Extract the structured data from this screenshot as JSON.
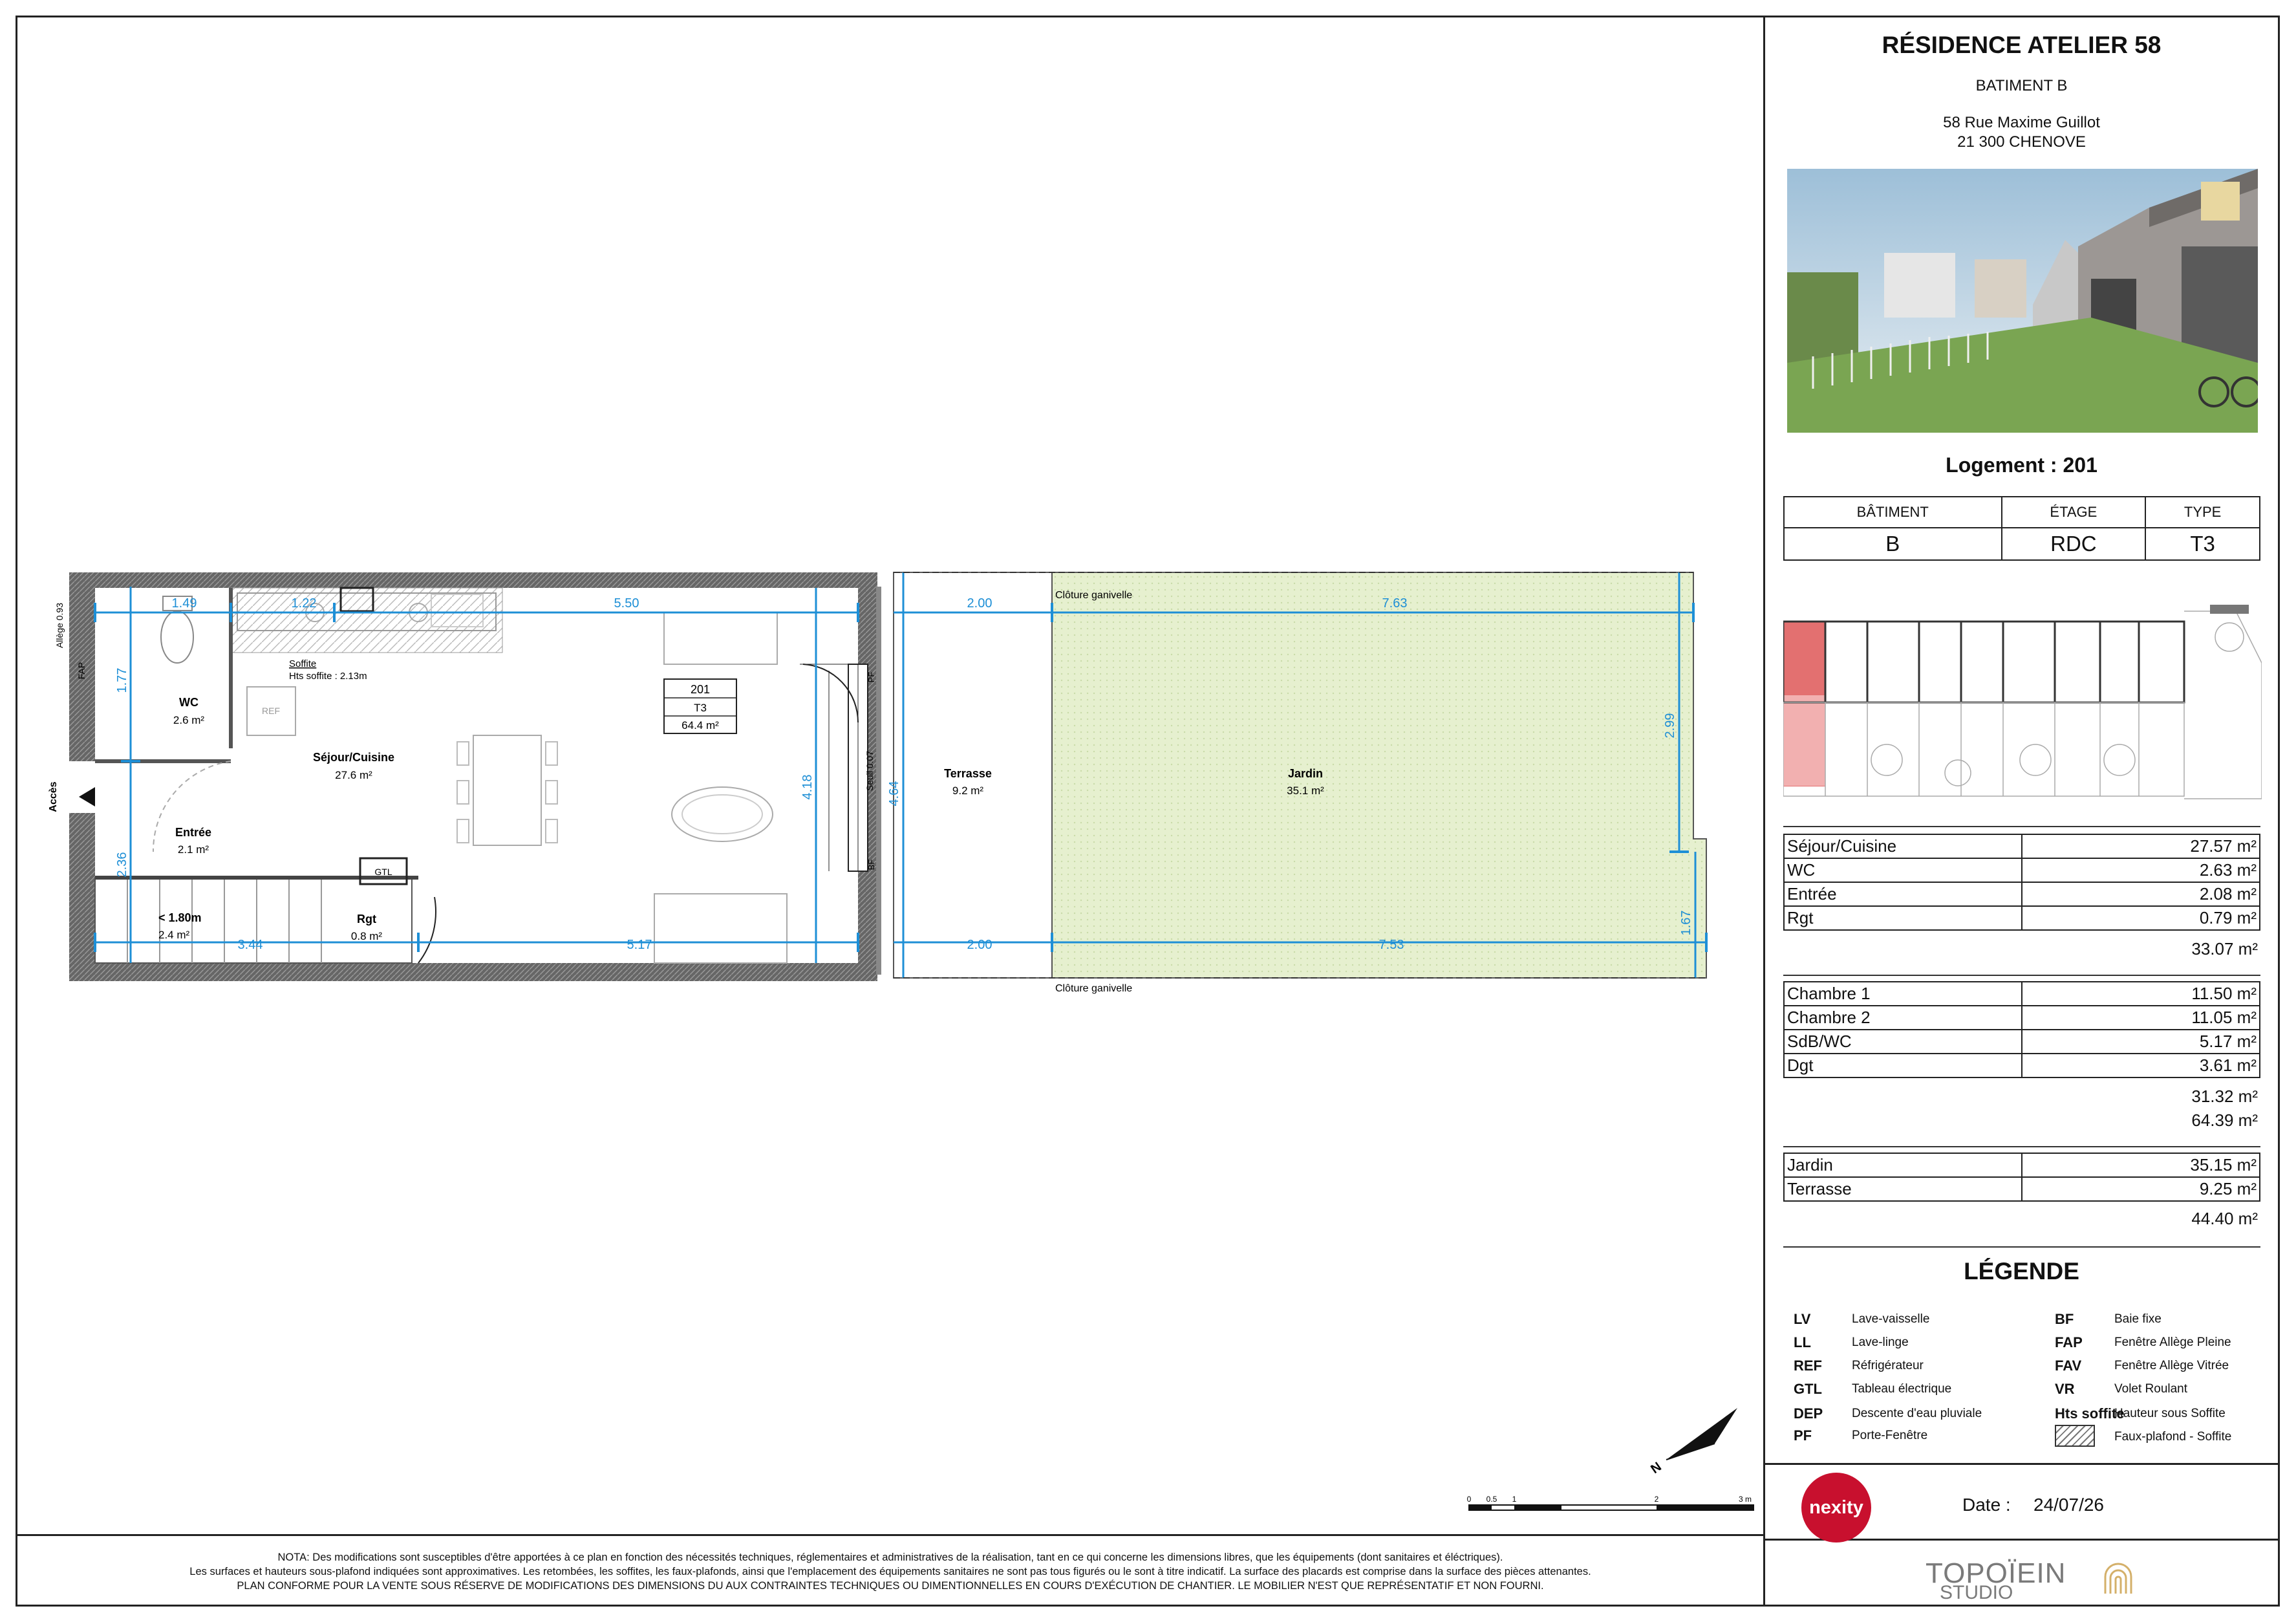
{
  "title": {
    "residence": "RÉSIDENCE ATELIER 58",
    "batiment": "BATIMENT B",
    "address_line1": "58 Rue Maxime Guillot",
    "address_line2": "21 300 CHENOVE",
    "logement": "Logement : 201"
  },
  "info_table": {
    "headers": [
      "BÂTIMENT",
      "ÉTAGE",
      "TYPE"
    ],
    "values": [
      "B",
      "RDC",
      "T3"
    ]
  },
  "surfaces": {
    "group1": [
      {
        "label": "Séjour/Cuisine",
        "value": "27.57 m²"
      },
      {
        "label": "WC",
        "value": "2.63 m²"
      },
      {
        "label": "Entrée",
        "value": "2.08 m²"
      },
      {
        "label": "Rgt",
        "value": "0.79 m²"
      }
    ],
    "group1_total": "33.07 m²",
    "group2": [
      {
        "label": "Chambre 1",
        "value": "11.50 m²"
      },
      {
        "label": "Chambre 2",
        "value": "11.05 m²"
      },
      {
        "label": "SdB/WC",
        "value": "5.17 m²"
      },
      {
        "label": "Dgt",
        "value": "3.61 m²"
      }
    ],
    "group2_total": "31.32 m²",
    "grand_total": "64.39 m²",
    "group3": [
      {
        "label": "Jardin",
        "value": "35.15 m²"
      },
      {
        "label": "Terrasse",
        "value": "9.25 m²"
      }
    ],
    "group3_total": "44.40 m²"
  },
  "legend": {
    "title": "LÉGENDE",
    "left": [
      {
        "code": "LV",
        "label": "Lave-vaisselle"
      },
      {
        "code": "LL",
        "label": "Lave-linge"
      },
      {
        "code": "REF",
        "label": "Réfrigérateur"
      },
      {
        "code": "GTL",
        "label": "Tableau électrique"
      },
      {
        "code": "DEP",
        "label": "Descente d'eau pluviale"
      },
      {
        "code": "PF",
        "label": "Porte-Fenêtre"
      }
    ],
    "right": [
      {
        "code": "BF",
        "label": "Baie fixe"
      },
      {
        "code": "FAP",
        "label": "Fenêtre Allège Pleine"
      },
      {
        "code": "FAV",
        "label": "Fenêtre Allège Vitrée"
      },
      {
        "code": "VR",
        "label": "Volet Roulant"
      },
      {
        "code": "Hts soffite",
        "label": "Hauteur sous Soffite"
      },
      {
        "code": "",
        "label": "Faux-plafond - Soffite"
      }
    ]
  },
  "footer": {
    "brand": "nexity",
    "date_label": "Date :",
    "date_value": "24/07/26",
    "studio_name": "TOPOÏEIN",
    "studio_sub": "STUDIO",
    "note_line1": "NOTA: Des modifications sont susceptibles d'être apportées à ce plan en fonction des nécessités techniques, réglementaires et administratives de la réalisation, tant en ce qui concerne les dimensions libres, que les équipements (dont sanitaires et éléctriques).",
    "note_line2": "Les surfaces et hauteurs sous-plafond indiquées sont approximatives. Les retombées, les soffites, les faux-plafonds, ainsi que l'emplacement des équipements sanitaires ne sont pas tous figurés ou le sont à titre indicatif. La surface des placards est comprise dans la surface des pièces attenantes.",
    "note_line3": "PLAN CONFORME POUR LA VENTE SOUS RÉSERVE DE MODIFICATIONS DES DIMENSIONS DU AUX CONTRAINTES TECHNIQUES OU DIMENTIONNELLES EN COURS D'EXÉCUTION DE CHANTIER. LE MOBILIER N'EST QUE REPRÉSENTATIF ET NON FOURNI."
  },
  "plan": {
    "rooms": {
      "wc": {
        "name": "WC",
        "area": "2.6 m²"
      },
      "sejour": {
        "name": "Séjour/Cuisine",
        "area": "27.6 m²"
      },
      "entree": {
        "name": "Entrée",
        "area": "2.1 m²"
      },
      "rgt": {
        "name": "Rgt",
        "area": "0.8 m²"
      },
      "stair": {
        "name": "< 1.80m",
        "area": "2.4 m²"
      },
      "terrasse": {
        "name": "Terrasse",
        "area": "9.2 m²"
      },
      "jardin": {
        "name": "Jardin",
        "area": "35.1 m²"
      }
    },
    "tag": {
      "number": "201",
      "type": "T3",
      "area": "64.4 m²"
    },
    "labels": {
      "soffite": "Soffite",
      "soffite_h": "Hts soffite : 2.13m",
      "ref": "REF",
      "gtl": "GTL",
      "acces": "Accès",
      "allege": "Allège 0.93",
      "fap": "FAP",
      "pf": "PF",
      "bf": "BF",
      "seuil": "Seuil 0.07",
      "cloture_top": "Clôture ganivelle",
      "cloture_bottom": "Clôture ganivelle",
      "north": "N"
    },
    "dims": {
      "top_149": "1.49",
      "top_122": "1.22",
      "top_550": "5.50",
      "top_200": "2.00",
      "top_763": "7.63",
      "bot_344": "3.44",
      "bot_517": "5.17",
      "bot_200": "2.00",
      "bot_753": "7.53",
      "v_177": "1.77",
      "v_236": "2.36",
      "v_418": "4.18",
      "v_464": "4.64",
      "v_299": "2.99",
      "v_167": "1.67"
    },
    "scale": [
      "0",
      "0.5",
      "1",
      "2",
      "3 m"
    ]
  },
  "colors": {
    "garden": "#e6f0cf",
    "dim_line": "#1e8fd6",
    "highlight_unit": "#e06060",
    "wall": "#555555"
  }
}
